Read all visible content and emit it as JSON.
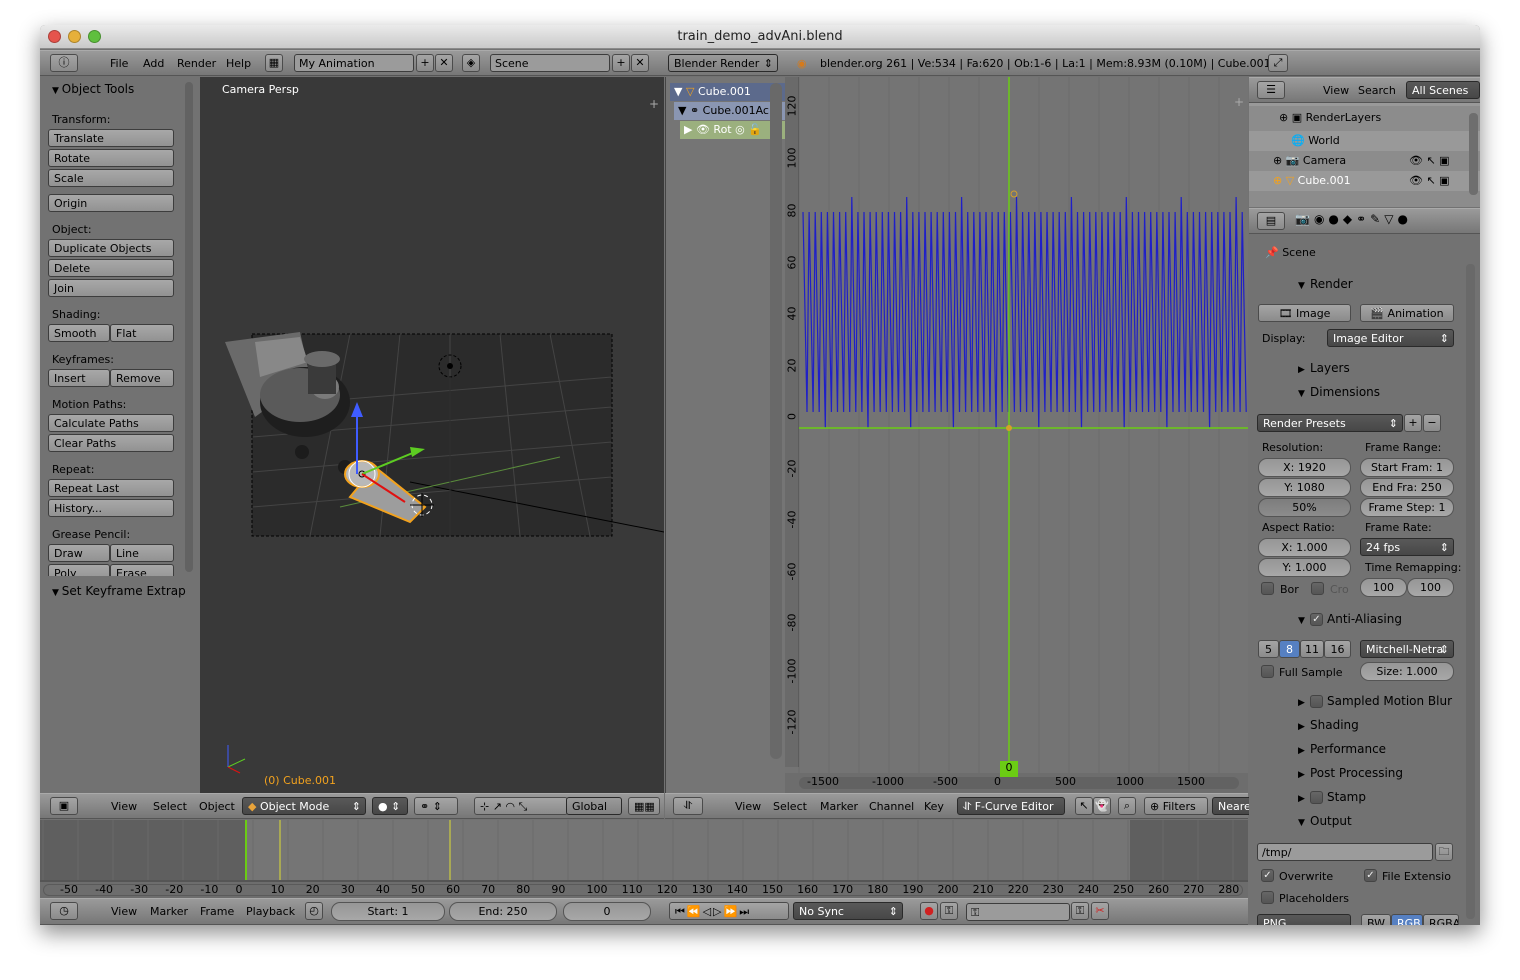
{
  "window": {
    "title": "train_demo_advAni.blend"
  },
  "info_header": {
    "menus": [
      "File",
      "Add",
      "Render",
      "Help"
    ],
    "layout_name": "My Animation",
    "scene_name": "Scene",
    "engine": "Blender Render",
    "stats": "blender.org 261 | Ve:534 | Fa:620 | Ob:1-6 | La:1 | Mem:8.93M (0.10M) | Cube.001"
  },
  "tool_shelf": {
    "header": "Object Tools",
    "transform_label": "Transform:",
    "translate": "Translate",
    "rotate": "Rotate",
    "scale": "Scale",
    "origin": "Origin",
    "object_label": "Object:",
    "duplicate": "Duplicate Objects",
    "delete": "Delete",
    "join": "Join",
    "shading_label": "Shading:",
    "smooth": "Smooth",
    "flat": "Flat",
    "keyframes_label": "Keyframes:",
    "insert": "Insert",
    "remove": "Remove",
    "motion_label": "Motion Paths:",
    "calc_paths": "Calculate Paths",
    "clear_paths": "Clear Paths",
    "repeat_label": "Repeat:",
    "repeat_last": "Repeat Last",
    "history": "History...",
    "grease_label": "Grease Pencil:",
    "draw": "Draw",
    "line": "Line",
    "poly": "Poly",
    "erase": "Erase",
    "keyframe_extrap": "Set Keyframe Extrap"
  },
  "viewport": {
    "label": "Camera Persp",
    "object_label": "(0) Cube.001",
    "menus": [
      "View",
      "Select",
      "Object"
    ],
    "mode": "Object Mode",
    "orientation": "Global"
  },
  "graph_channels": {
    "items": [
      "Cube.001",
      "Cube.001Ac",
      "Rot"
    ]
  },
  "graph": {
    "y_ticks": [
      "120",
      "100",
      "80",
      "60",
      "40",
      "20",
      "0",
      "-20",
      "-40",
      "-60",
      "-80",
      "-100",
      "-120"
    ],
    "x_ticks": [
      "-1500",
      "-1000",
      "-500",
      "0",
      "500",
      "1000",
      "1500"
    ],
    "current_frame": "0",
    "menus": [
      "View",
      "Select",
      "Marker",
      "Channel",
      "Key"
    ],
    "editor_type": "F-Curve Editor",
    "filters": "Filters",
    "nearest": "Neare"
  },
  "outliner": {
    "menus": [
      "View",
      "Search"
    ],
    "scope": "All Scenes",
    "items": [
      "RenderLayers",
      "World",
      "Camera",
      "Cube.001"
    ]
  },
  "properties": {
    "context": "Scene",
    "render_title": "Render",
    "image_btn": "Image",
    "animation_btn": "Animation",
    "display_label": "Display:",
    "display_value": "Image Editor",
    "layers": "Layers",
    "dimensions": "Dimensions",
    "render_presets": "Render Presets",
    "resolution_label": "Resolution:",
    "res_x": "X: 1920",
    "res_y": "Y: 1080",
    "res_pct": "50%",
    "frame_range_label": "Frame Range:",
    "start_frame": "Start Fram: 1",
    "end_frame": "End Fra: 250",
    "frame_step": "Frame Step: 1",
    "aspect_label": "Aspect Ratio:",
    "aspect_x": "X: 1.000",
    "aspect_y": "Y: 1.000",
    "frame_rate_label": "Frame Rate:",
    "fps": "24 fps",
    "time_remap_label": "Time Remapping:",
    "remap_old": "100",
    "remap_new": "100",
    "border": "Bor",
    "crop": "Cro",
    "aa_title": "Anti-Aliasing",
    "aa_samples": [
      "5",
      "8",
      "11",
      "16"
    ],
    "aa_filter": "Mitchell-Netra",
    "full_sample": "Full Sample",
    "filter_size": "Size: 1.000",
    "motion_blur": "Sampled Motion Blur",
    "shading": "Shading",
    "performance": "Performance",
    "post_processing": "Post Processing",
    "stamp": "Stamp",
    "output": "Output",
    "output_path": "/tmp/",
    "overwrite": "Overwrite",
    "file_ext": "File Extensio",
    "placeholders": "Placeholders",
    "format": "PNG",
    "bw": "BW",
    "rgb": "RGB",
    "rgba": "RGBA"
  },
  "timeline": {
    "ticks": [
      "-50",
      "-40",
      "-30",
      "-20",
      "-10",
      "0",
      "10",
      "20",
      "30",
      "40",
      "50",
      "60",
      "70",
      "80",
      "90",
      "100",
      "110",
      "120",
      "130",
      "140",
      "150",
      "160",
      "170",
      "180",
      "190",
      "200",
      "210",
      "220",
      "230",
      "240",
      "250",
      "260",
      "270",
      "280"
    ],
    "menus": [
      "View",
      "Marker",
      "Frame",
      "Playback"
    ],
    "start": "Start: 1",
    "end": "End: 250",
    "current": "0",
    "sync": "No Sync"
  },
  "colors": {
    "curve": "#1f1fc8",
    "accent_green": "#6bcc14",
    "selected_orange": "#f2a21e"
  }
}
